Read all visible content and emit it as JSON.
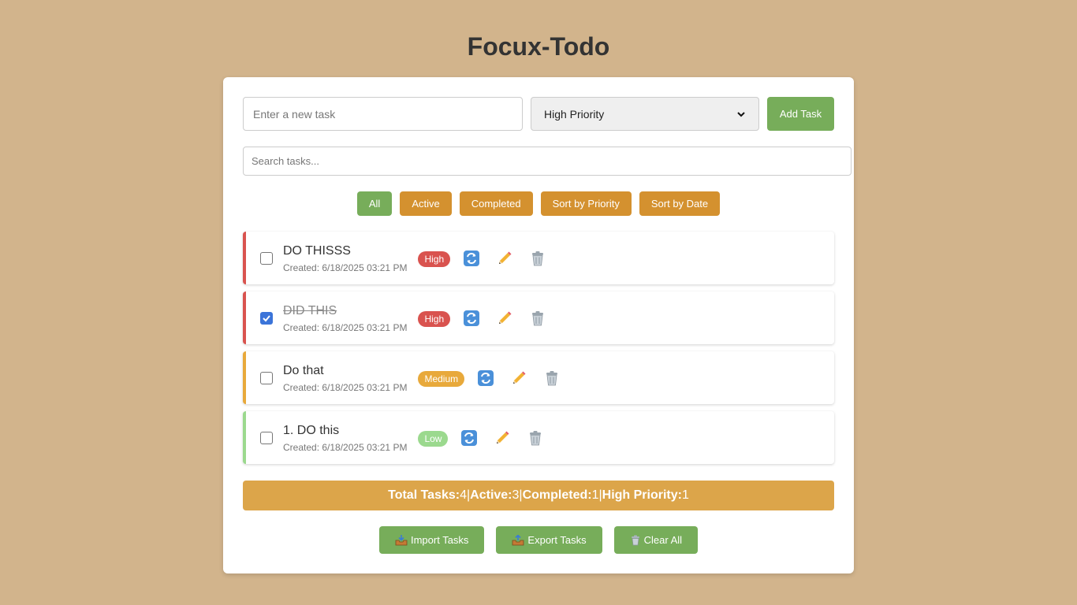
{
  "app": {
    "title": "Focux-Todo"
  },
  "form": {
    "task_placeholder": "Enter a new task",
    "priority_selected": "High Priority",
    "add_label": "Add Task",
    "search_placeholder": "Search tasks..."
  },
  "filters": [
    {
      "label": "All",
      "active": true
    },
    {
      "label": "Active",
      "active": false
    },
    {
      "label": "Completed",
      "active": false
    },
    {
      "label": "Sort by Priority",
      "active": false
    },
    {
      "label": "Sort by Date",
      "active": false
    }
  ],
  "tasks": [
    {
      "name": "DO THISSS",
      "created": "Created: 6/18/2025 03:21 PM",
      "priority": "High",
      "completed": false
    },
    {
      "name": "DID THIS",
      "created": "Created: 6/18/2025 03:21 PM",
      "priority": "High",
      "completed": true
    },
    {
      "name": "Do that",
      "created": "Created: 6/18/2025 03:21 PM",
      "priority": "Medium",
      "completed": false
    },
    {
      "name": "1. DO this",
      "created": "Created: 6/18/2025 03:21 PM",
      "priority": "Low",
      "completed": false
    }
  ],
  "priority_colors": {
    "High": "#d9534f",
    "Medium": "#e8a93b",
    "Low": "#9bd98e"
  },
  "task_icons": [
    "repeat-icon",
    "pencil-icon",
    "trash-icon"
  ],
  "stats": {
    "total_label": "Total Tasks:",
    "total": "4",
    "active_label": "Active:",
    "active": "3",
    "completed_label": "Completed:",
    "completed": "1",
    "high_label": "High Priority:",
    "high": "1",
    "separator": "|"
  },
  "actions": {
    "import_label": "Import Tasks",
    "export_label": "Export Tasks",
    "clear_label": "Clear All"
  }
}
